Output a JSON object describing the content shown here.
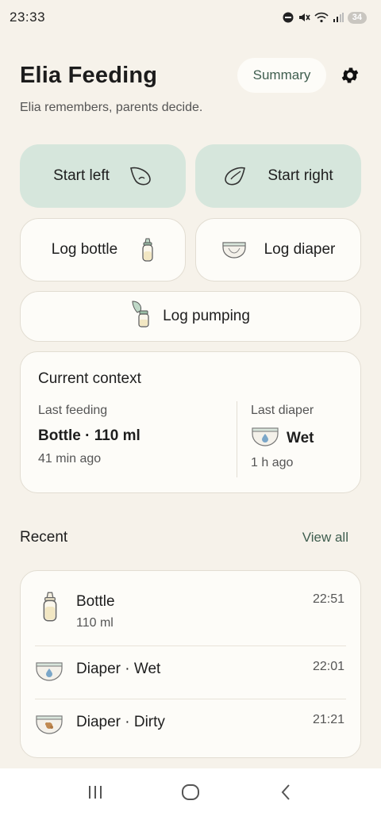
{
  "status_bar": {
    "time": "23:33",
    "battery": "34",
    "icons": [
      "do-not-disturb-icon",
      "mute-icon",
      "wifi-icon",
      "signal-icon",
      "battery-icon"
    ]
  },
  "header": {
    "title": "Elia Feeding",
    "summary_label": "Summary",
    "subtitle": "Elia remembers, parents decide."
  },
  "actions": {
    "start_left": "Start left",
    "start_right": "Start right",
    "log_bottle": "Log bottle",
    "log_diaper": "Log diaper",
    "log_pumping": "Log pumping"
  },
  "context": {
    "title": "Current context",
    "feeding_label": "Last feeding",
    "feeding_value": "Bottle · 110 ml",
    "feeding_ago": "41 min ago",
    "diaper_label": "Last diaper",
    "diaper_value": "Wet",
    "diaper_ago": "1 h ago"
  },
  "recent": {
    "title": "Recent",
    "view_all": "View all",
    "items": [
      {
        "title": "Bottle",
        "sub": "110 ml",
        "time": "22:51",
        "icon": "bottle-icon"
      },
      {
        "title": "Diaper · Wet",
        "sub": "",
        "time": "22:01",
        "icon": "diaper-wet-icon"
      },
      {
        "title": "Diaper · Dirty",
        "sub": "",
        "time": "21:21",
        "icon": "diaper-dirty-icon"
      }
    ]
  },
  "colors": {
    "background": "#f6f2ea",
    "accent_green": "#d6e6dc",
    "accent_text": "#3f5e4f",
    "card": "#fdfcf8"
  }
}
